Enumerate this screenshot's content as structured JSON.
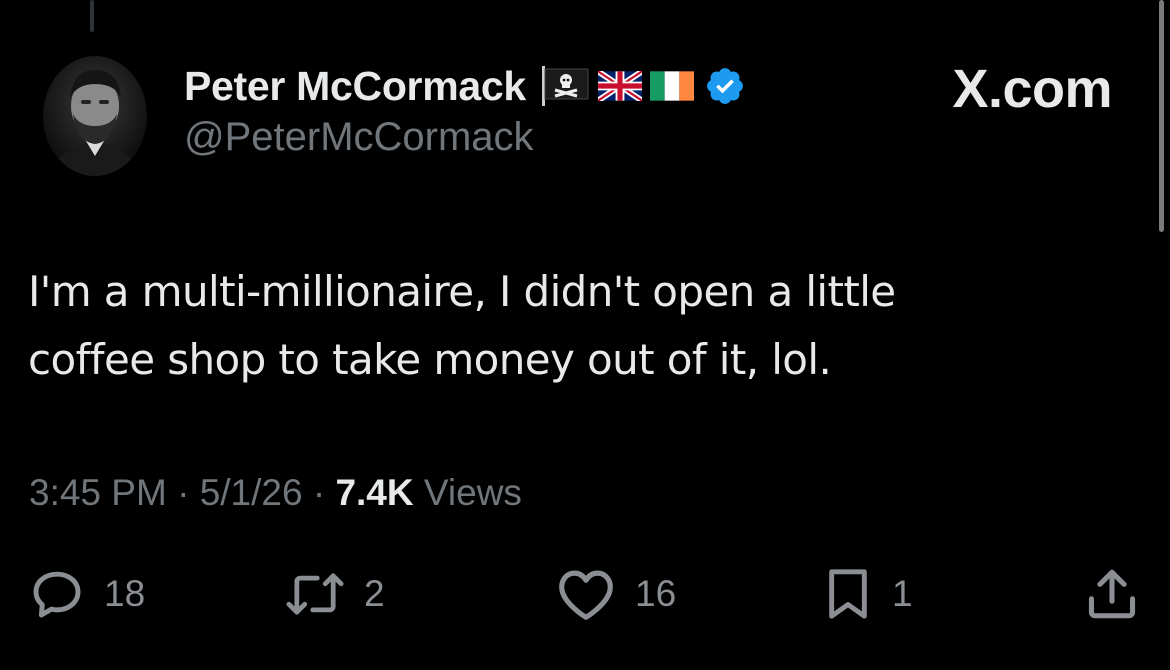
{
  "author": {
    "display_name": "Peter McCormack",
    "handle": "@PeterMcCormack",
    "name_emojis": [
      "pirate-flag",
      "uk-flag",
      "ireland-flag"
    ],
    "verified": true
  },
  "brand": {
    "label": "X.com"
  },
  "tweet": {
    "text_line_1": "I'm a multi-millionaire, I didn't open a little",
    "text_line_2": "coffee shop to take money out of it, lol."
  },
  "meta": {
    "time": "3:45 PM",
    "separator": "·",
    "date": "5/1/26",
    "views_count": "7.4K",
    "views_label": "Views"
  },
  "actions": {
    "reply_count": "18",
    "retweet_count": "2",
    "like_count": "16",
    "bookmark_count": "1"
  },
  "colors": {
    "background": "#000000",
    "primary_text": "#e7e9ea",
    "secondary_text": "#71767b",
    "verified_blue": "#1d9bf0"
  }
}
